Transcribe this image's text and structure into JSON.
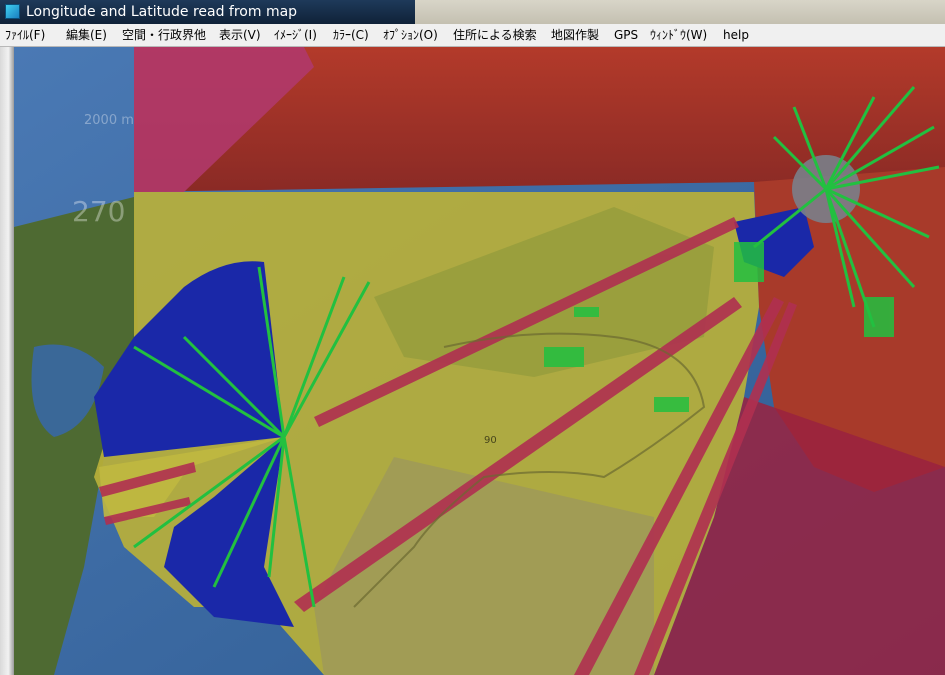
{
  "window": {
    "title": "Longitude and Latitude read from map",
    "icon": "app-icon"
  },
  "menu": [
    "ﾌｧｲﾙ(F)",
    "編集(E)",
    "空間・行政界他",
    "表示(V)",
    "ｲﾒｰｼﾞ(I)",
    "ｶﾗｰ(C)",
    "ｵﾌﾟｼｮﾝ(O)",
    "住所による検索",
    "地図作製",
    "GPS",
    "ｳｨﾝﾄﾞｳ(W)",
    "help"
  ],
  "map": {
    "depth_label": "2000 m",
    "scale_label": "270",
    "grid_label": "90",
    "colors": {
      "sea": "#3d6ea8",
      "land": "#4e6a32",
      "visible_overlay": "#c8c040",
      "hidden_overlay": "#b03050",
      "sector_blue": "#1a28a8",
      "edge_green": "#22c040"
    }
  }
}
